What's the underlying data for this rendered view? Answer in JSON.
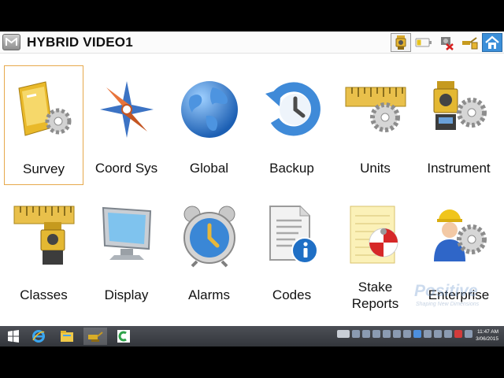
{
  "app": {
    "title": "HYBRID VIDEO1"
  },
  "status_icons": [
    "total-station-icon",
    "battery-icon",
    "rover-disconnected-icon",
    "survey-pole-icon",
    "home-icon"
  ],
  "tiles": [
    {
      "label": "Survey",
      "icon": "survey-folder-gear-icon",
      "selected": true
    },
    {
      "label": "Coord Sys",
      "icon": "compass-rose-icon",
      "selected": false
    },
    {
      "label": "Global",
      "icon": "globe-icon",
      "selected": false
    },
    {
      "label": "Backup",
      "icon": "backup-clock-icon",
      "selected": false
    },
    {
      "label": "Units",
      "icon": "ruler-gear-icon",
      "selected": false
    },
    {
      "label": "Instrument",
      "icon": "instrument-gear-icon",
      "selected": false
    },
    {
      "label": "Classes",
      "icon": "ruler-instrument-icon",
      "selected": false
    },
    {
      "label": "Display",
      "icon": "monitor-icon",
      "selected": false
    },
    {
      "label": "Alarms",
      "icon": "alarm-clock-icon",
      "selected": false
    },
    {
      "label": "Codes",
      "icon": "document-info-icon",
      "selected": false
    },
    {
      "label_line1": "Stake",
      "label_line2": "Reports",
      "icon": "stake-report-icon",
      "selected": false
    },
    {
      "label": "Enterprise",
      "icon": "worker-gear-icon",
      "selected": false
    }
  ],
  "watermark": {
    "main": "Positive",
    "sub": "Shaping New Dimensions"
  },
  "taskbar": {
    "items": [
      "start-icon",
      "internet-explorer-icon",
      "file-explorer-icon",
      "instrument-app-icon",
      "green-app-icon"
    ],
    "time": "11:47 AM",
    "date": "3/06/2015"
  },
  "colors": {
    "selection_border": "#e7a94c",
    "taskbar": "#3d4046",
    "home_button": "#3b8fd9"
  }
}
